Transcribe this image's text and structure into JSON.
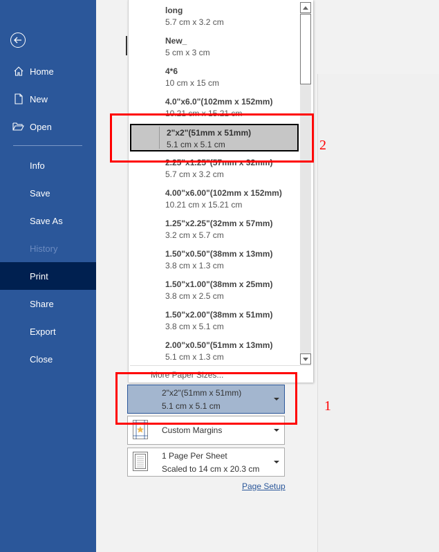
{
  "sidebar": {
    "back_label": "Back",
    "items": [
      {
        "label": "Home",
        "icon": "home-icon"
      },
      {
        "label": "New",
        "icon": "new-document-icon"
      },
      {
        "label": "Open",
        "icon": "open-folder-icon"
      },
      {
        "label": "Info"
      },
      {
        "label": "Save"
      },
      {
        "label": "Save As"
      },
      {
        "label": "History",
        "disabled": true
      },
      {
        "label": "Print",
        "active": true
      },
      {
        "label": "Share"
      },
      {
        "label": "Export"
      },
      {
        "label": "Close"
      }
    ]
  },
  "paper_dropdown": {
    "items": [
      {
        "name": "long",
        "size": "5.7 cm x 3.2 cm"
      },
      {
        "name": "New_",
        "size": "5 cm x 3 cm"
      },
      {
        "name": "4*6",
        "size": "10 cm x 15 cm"
      },
      {
        "name": "4.0\"x6.0\"(102mm x 152mm)",
        "size": "10.21 cm x 15.21 cm"
      },
      {
        "name": "2\"x2\"(51mm x 51mm)",
        "size": "5.1 cm x 5.1 cm",
        "selected": true
      },
      {
        "name": "2.25\"x1.25\"(57mm x 32mm)",
        "size": "5.7 cm x 3.2 cm"
      },
      {
        "name": "4.00\"x6.00\"(102mm x 152mm)",
        "size": "10.21 cm x 15.21 cm"
      },
      {
        "name": "1.25\"x2.25\"(32mm x 57mm)",
        "size": "3.2 cm x 5.7 cm"
      },
      {
        "name": "1.50\"x0.50\"(38mm x 13mm)",
        "size": "3.8 cm x 1.3 cm"
      },
      {
        "name": "1.50\"x1.00\"(38mm x 25mm)",
        "size": "3.8 cm x 2.5 cm"
      },
      {
        "name": "1.50\"x2.00\"(38mm x 51mm)",
        "size": "3.8 cm x 5.1 cm"
      },
      {
        "name": "2.00\"x0.50\"(51mm x 13mm)",
        "size": "5.1 cm x 1.3 cm"
      }
    ],
    "more_label": "More Paper Sizes..."
  },
  "settings": {
    "paper_size": {
      "line1": "2\"x2\"(51mm x 51mm)",
      "line2": "5.1 cm x 5.1 cm"
    },
    "margins": {
      "line1": "Custom Margins"
    },
    "pages_per_sheet": {
      "line1": "1 Page Per Sheet",
      "line2": "Scaled to 14 cm x 20.3 cm"
    },
    "page_setup_link": "Page Setup"
  },
  "annotations": [
    {
      "label": "1",
      "color": "#ff0000"
    },
    {
      "label": "2",
      "color": "#ff0000"
    }
  ],
  "colors": {
    "sidebar": "#2b579a",
    "active_nav": "#002050",
    "annotation": "#ff0000"
  }
}
